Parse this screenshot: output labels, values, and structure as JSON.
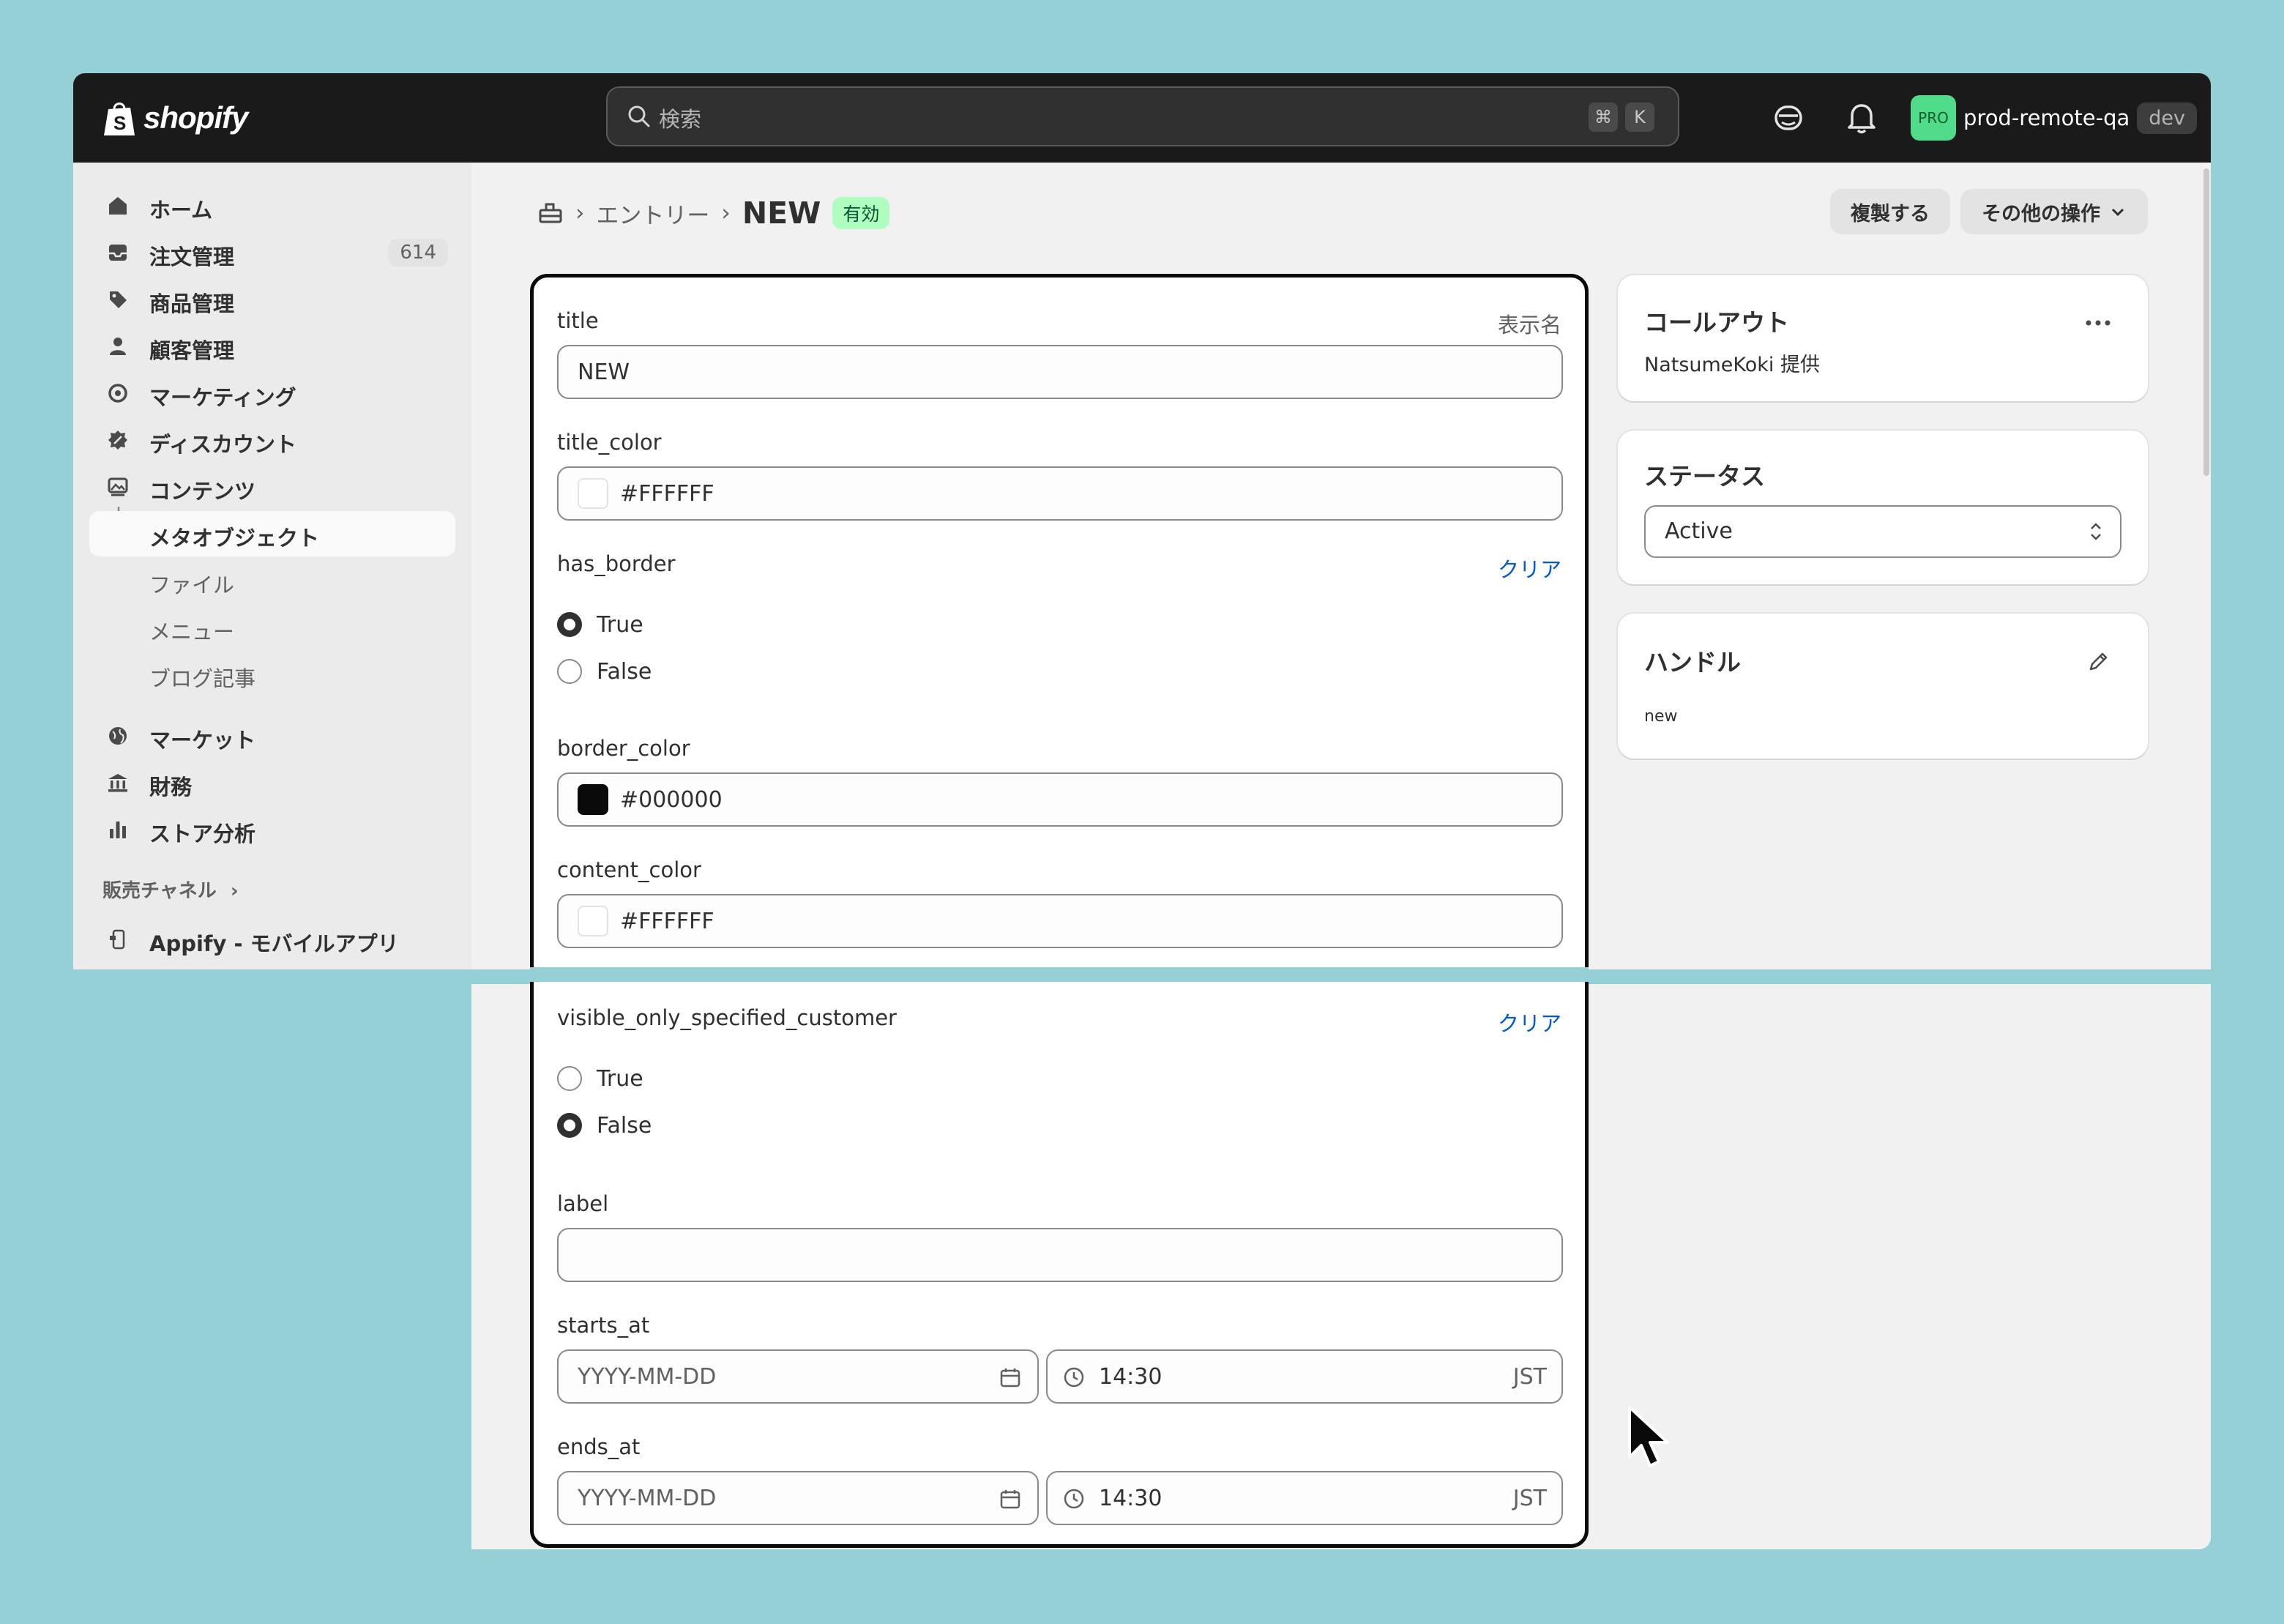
{
  "topbar": {
    "logo_text": "shopify",
    "search_placeholder": "検索",
    "shortcut_cmd": "⌘",
    "shortcut_key": "K",
    "avatar_text": "PRO",
    "store_name": "prod-remote-qa",
    "env_badge": "dev"
  },
  "sidebar": {
    "items": [
      {
        "label": "ホーム",
        "icon": "home-icon"
      },
      {
        "label": "注文管理",
        "icon": "inbox-icon",
        "badge": "614"
      },
      {
        "label": "商品管理",
        "icon": "tag-icon"
      },
      {
        "label": "顧客管理",
        "icon": "person-icon"
      },
      {
        "label": "マーケティング",
        "icon": "target-icon"
      },
      {
        "label": "ディスカウント",
        "icon": "discount-icon"
      },
      {
        "label": "コンテンツ",
        "icon": "image-icon"
      }
    ],
    "content_sub": [
      {
        "label": "メタオブジェクト"
      },
      {
        "label": "ファイル"
      },
      {
        "label": "メニュー"
      },
      {
        "label": "ブログ記事"
      }
    ],
    "items2": [
      {
        "label": "マーケット",
        "icon": "globe-icon"
      },
      {
        "label": "財務",
        "icon": "bank-icon"
      },
      {
        "label": "ストア分析",
        "icon": "chart-icon"
      }
    ],
    "channels_heading": "販売チャネル",
    "channel_app": "Appify - モバイルアプリ"
  },
  "header": {
    "breadcrumb_parent": "エントリー",
    "title": "NEW",
    "status_pill": "有効",
    "duplicate_button": "複製する",
    "more_actions_button": "その他の操作"
  },
  "form": {
    "title": {
      "label": "title",
      "hint": "表示名",
      "value": "NEW"
    },
    "title_color": {
      "label": "title_color",
      "value": "#FFFFFF",
      "swatch": "#FFFFFF"
    },
    "has_border": {
      "label": "has_border",
      "clear": "クリア",
      "options": [
        "True",
        "False"
      ],
      "selected": "True"
    },
    "border_color": {
      "label": "border_color",
      "value": "#000000",
      "swatch": "#000000"
    },
    "content_color": {
      "label": "content_color",
      "value": "#FFFFFF",
      "swatch": "#FFFFFF"
    },
    "visible_only_specified_customer": {
      "label": "visible_only_specified_customer",
      "clear": "クリア",
      "options": [
        "True",
        "False"
      ],
      "selected": "False"
    },
    "label": {
      "label": "label",
      "value": ""
    },
    "starts_at": {
      "label": "starts_at",
      "date_placeholder": "YYYY-MM-DD",
      "time": "14:30",
      "tz": "JST"
    },
    "ends_at": {
      "label": "ends_at",
      "date_placeholder": "YYYY-MM-DD",
      "time": "14:30",
      "tz": "JST"
    }
  },
  "side": {
    "callout": {
      "title": "コールアウト",
      "provider": "NatsumeKoki 提供"
    },
    "status": {
      "title": "ステータス",
      "value": "Active"
    },
    "handle": {
      "title": "ハンドル",
      "value": "new"
    }
  },
  "colors": {
    "accent_link": "#005bd3",
    "success_pill": "#affebf",
    "topbar": "#1a1a1a",
    "background": "#95d0d7"
  }
}
